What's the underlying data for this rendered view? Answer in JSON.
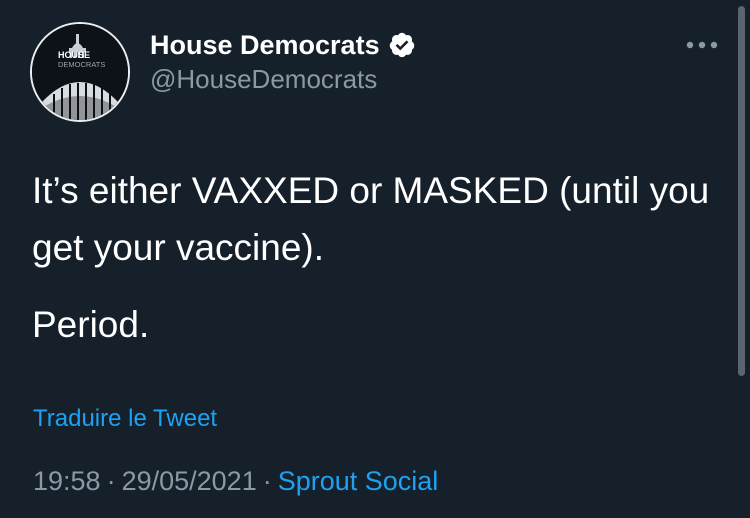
{
  "author": {
    "display_name": "House Democrats",
    "handle": "@HouseDemocrats",
    "avatar_text_line1": "HOUSE",
    "avatar_text_line2": "DEMOCRATS"
  },
  "tweet": {
    "paragraph1": "It’s either VAXXED or MASKED (until you get your vaccine).",
    "paragraph2": "Period.",
    "translate_label": "Traduire le Tweet"
  },
  "meta": {
    "time": "19:58",
    "date": "29/05/2021",
    "separator": "·",
    "source": "Sprout Social"
  },
  "icons": {
    "verified": "verified-badge-icon",
    "more": "more-options-icon"
  },
  "colors": {
    "background": "#15202b",
    "text": "#ffffff",
    "secondary": "#8b98a5",
    "accent": "#1da1f2"
  }
}
